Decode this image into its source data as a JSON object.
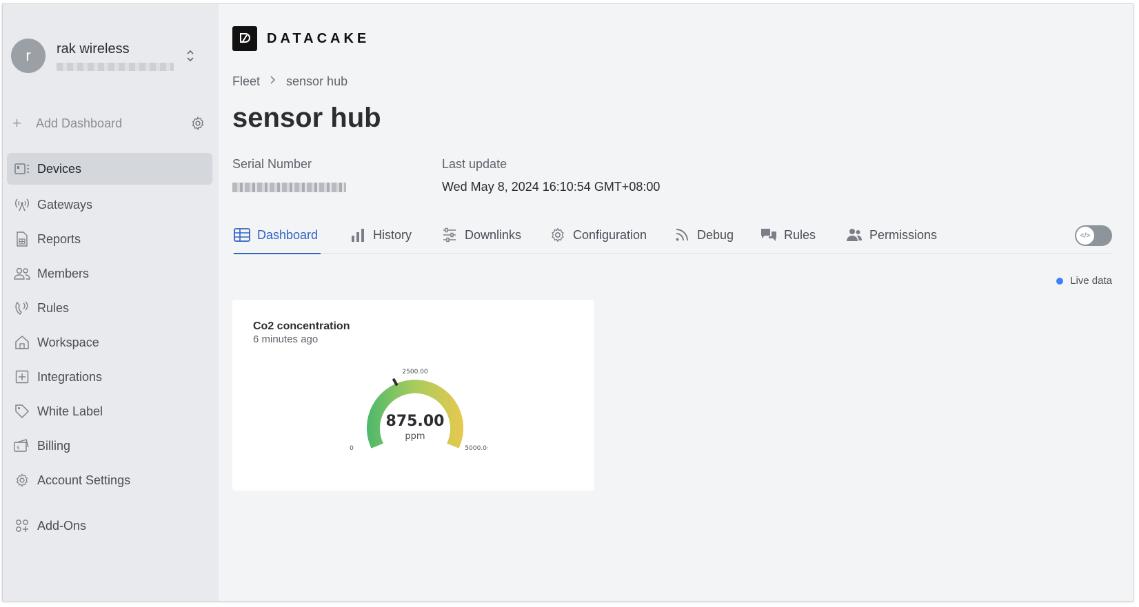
{
  "account": {
    "initial": "r",
    "name": "rak wireless"
  },
  "sidebar": {
    "add_dashboard": "Add Dashboard",
    "items": [
      {
        "label": "Devices",
        "icon": "devices-icon",
        "active": true
      },
      {
        "label": "Gateways",
        "icon": "gateway-icon"
      },
      {
        "label": "Reports",
        "icon": "report-icon"
      },
      {
        "label": "Members",
        "icon": "members-icon"
      },
      {
        "label": "Rules",
        "icon": "rules-icon"
      },
      {
        "label": "Workspace",
        "icon": "workspace-icon"
      },
      {
        "label": "Integrations",
        "icon": "integrations-icon"
      },
      {
        "label": "White Label",
        "icon": "tag-icon"
      },
      {
        "label": "Billing",
        "icon": "billing-icon"
      },
      {
        "label": "Account Settings",
        "icon": "gear-icon"
      },
      {
        "label": "Add-Ons",
        "icon": "addons-icon"
      }
    ]
  },
  "brand": {
    "name": "DATACAKE"
  },
  "breadcrumb": {
    "root": "Fleet",
    "current": "sensor hub"
  },
  "page": {
    "title": "sensor hub"
  },
  "meta": {
    "serial_label": "Serial Number",
    "last_update_label": "Last update",
    "last_update_value": "Wed May 8, 2024 16:10:54 GMT+08:00"
  },
  "tabs": [
    {
      "label": "Dashboard",
      "icon": "table-icon",
      "active": true
    },
    {
      "label": "History",
      "icon": "bar-chart-icon"
    },
    {
      "label": "Downlinks",
      "icon": "sliders-icon"
    },
    {
      "label": "Configuration",
      "icon": "cog-icon"
    },
    {
      "label": "Debug",
      "icon": "rss-icon"
    },
    {
      "label": "Rules",
      "icon": "chat-icon"
    },
    {
      "label": "Permissions",
      "icon": "users-icon"
    }
  ],
  "live": {
    "label": "Live data",
    "color": "#3b82f6"
  },
  "widget": {
    "title": "Co2 concentration",
    "subtitle": "6 minutes ago",
    "value": "875.00",
    "unit": "ppm",
    "min_label": "0",
    "mid_label": "2500.00",
    "max_label": "5000.00",
    "min": 0,
    "max": 5000,
    "reading": 875
  }
}
